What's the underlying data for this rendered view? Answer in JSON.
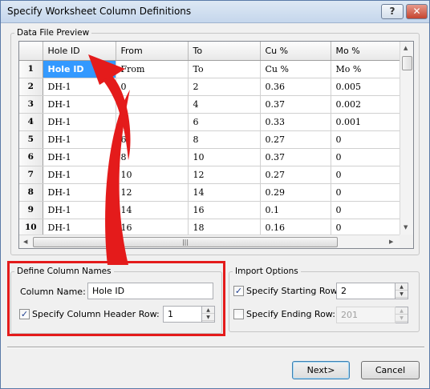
{
  "window": {
    "title": "Specify Worksheet Column Definitions",
    "help_label": "?",
    "close_label": "✕"
  },
  "preview": {
    "legend": "Data File Preview",
    "columns": [
      "",
      "Hole ID",
      "From",
      "To",
      "Cu %",
      "Mo %"
    ],
    "rows": [
      [
        "1",
        "Hole ID",
        "From",
        "To",
        "Cu %",
        "Mo %"
      ],
      [
        "2",
        "DH-1",
        "0",
        "2",
        "0.36",
        "0.005"
      ],
      [
        "3",
        "DH-1",
        "2",
        "4",
        "0.37",
        "0.002"
      ],
      [
        "4",
        "DH-1",
        "4",
        "6",
        "0.33",
        "0.001"
      ],
      [
        "5",
        "DH-1",
        "6",
        "8",
        "0.27",
        "0"
      ],
      [
        "6",
        "DH-1",
        "8",
        "10",
        "0.37",
        "0"
      ],
      [
        "7",
        "DH-1",
        "10",
        "12",
        "0.27",
        "0"
      ],
      [
        "8",
        "DH-1",
        "12",
        "14",
        "0.29",
        "0"
      ],
      [
        "9",
        "DH-1",
        "14",
        "16",
        "0.1",
        "0"
      ],
      [
        "10",
        "DH-1",
        "16",
        "18",
        "0.16",
        "0"
      ]
    ]
  },
  "define": {
    "legend": "Define Column Names",
    "column_name_label": "Column Name:",
    "column_name_value": "Hole ID",
    "header_row_label": "Specify Column Header Row:",
    "header_row_checked": true,
    "header_row_value": "1"
  },
  "import": {
    "legend": "Import Options",
    "start_label": "Specify Starting Row:",
    "start_checked": true,
    "start_value": "2",
    "end_label": "Specify Ending Row:",
    "end_checked": false,
    "end_value": "201"
  },
  "buttons": {
    "next": "Next>",
    "cancel": "Cancel"
  },
  "colors": {
    "highlight": "#e41b1b",
    "selection": "#3399ff"
  }
}
